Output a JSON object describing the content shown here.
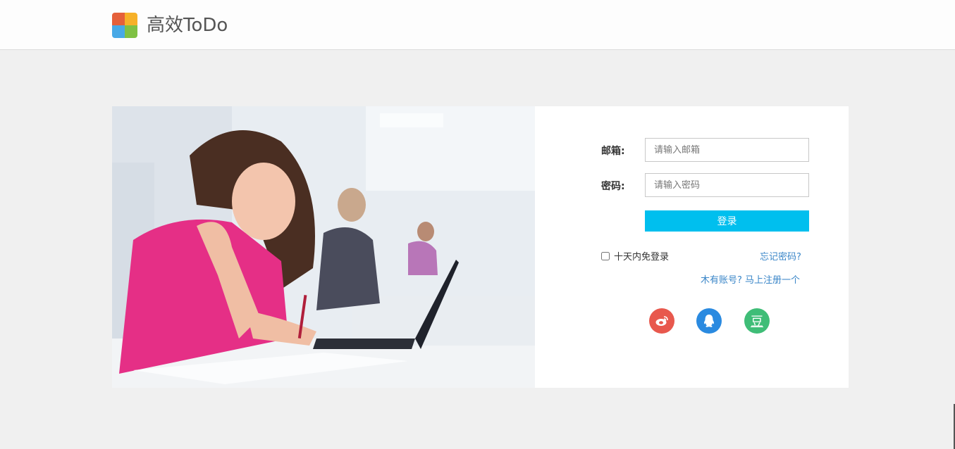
{
  "header": {
    "brand": "高效ToDo"
  },
  "login": {
    "email_label": "邮箱:",
    "email_placeholder": "请输入邮箱",
    "password_label": "密码:",
    "password_placeholder": "请输入密码",
    "submit_label": "登录",
    "remember_label": "十天内免登录",
    "forgot_label": "忘记密码?",
    "register_label": "木有账号? 马上注册一个"
  },
  "social": {
    "weibo_icon": "weibo-icon",
    "qq_icon": "qq-icon",
    "douban_glyph": "豆"
  },
  "colors": {
    "accent": "#00bfee",
    "link": "#3a86c8",
    "weibo": "#e8584d",
    "qq": "#2a8ae0",
    "douban": "#3fbd77"
  }
}
